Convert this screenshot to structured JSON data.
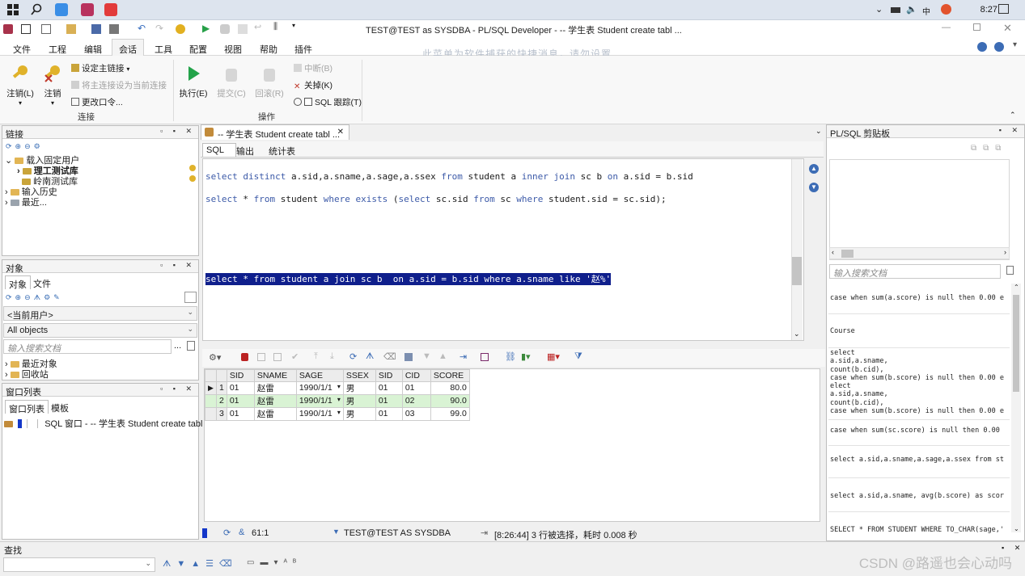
{
  "taskbar": {
    "clock": "8:27"
  },
  "window": {
    "title": "TEST@TEST as SYSDBA - PL/SQL Developer - -- 学生表 Student create tabl ..."
  },
  "menu": {
    "items": [
      "文件",
      "工程",
      "编辑",
      "会话",
      "工具",
      "配置",
      "视图",
      "帮助",
      "插件"
    ],
    "banner": "此菜单为软件捕获的快捷消息，请勿设置"
  },
  "ribbon": {
    "logoff1": "注销(L)",
    "logoff2": "注销",
    "set_main": "设定主链接",
    "set_main_current": "将主连接设为当前连接",
    "change_pwd": "更改口令...",
    "group_connect": "连接",
    "execute": "执行(E)",
    "commit": "提交(C)",
    "rollback": "回滚(R)",
    "break": "中断(B)",
    "close": "关掉(K)",
    "sql_trace": "SQL 跟踪(T)",
    "group_ops": "操作"
  },
  "connections": {
    "title": "链接",
    "items": [
      "载入固定用户",
      "理工测试库",
      "岭南测试库",
      "输入历史",
      "最近..."
    ]
  },
  "objects": {
    "title": "对象",
    "tab_objects": "对象",
    "tab_files": "文件",
    "current_user": "<当前用户>",
    "all_objects": "All objects",
    "search_placeholder": "输入搜索文档",
    "dots": "...",
    "items": [
      "最近对象",
      "回收站"
    ]
  },
  "window_list": {
    "title": "窗口列表",
    "tab_windows": "窗口列表",
    "tab_templates": "模板",
    "item": "SQL 窗口 - -- 学生表 Student create tabl ..."
  },
  "editor": {
    "doc_tab": "-- 学生表 Student create tabl ...",
    "tabs": [
      "SQL",
      "输出",
      "统计表"
    ],
    "line1_kw1": "select distinct",
    "line1_rest": " a.sid,a.sname,a.sage,a.ssex ",
    "line1_kw2": "from",
    "line1_mid": " student a ",
    "line1_kw3": "inner join",
    "line1_mid2": " sc b ",
    "line1_kw4": "on",
    "line1_end": " a.sid = b.sid",
    "line2_kw1": "select",
    "line2_a": " * ",
    "line2_kw2": "from",
    "line2_b": " student ",
    "line2_kw3": "where exists",
    "line2_c": " (",
    "line2_kw4": "select",
    "line2_d": " sc.sid ",
    "line2_kw5": "from",
    "line2_e": " sc ",
    "line2_kw6": "where",
    "line2_f": " student.sid = sc.sid);",
    "highlight": "select * from student a join sc b  on a.sid = b.sid where a.sname like '赵%'"
  },
  "grid": {
    "columns": [
      "SID",
      "SNAME",
      "SAGE",
      "SSEX",
      "SID",
      "CID",
      "SCORE"
    ],
    "rows": [
      {
        "n": "1",
        "sid": "01",
        "sname": "赵雷",
        "sage": "1990/1/1",
        "ssex": "男",
        "sid2": "01",
        "cid": "01",
        "score": "80.0"
      },
      {
        "n": "2",
        "sid": "01",
        "sname": "赵雷",
        "sage": "1990/1/1",
        "ssex": "男",
        "sid2": "01",
        "cid": "02",
        "score": "90.0"
      },
      {
        "n": "3",
        "sid": "01",
        "sname": "赵雷",
        "sage": "1990/1/1",
        "ssex": "男",
        "sid2": "01",
        "cid": "03",
        "score": "99.0"
      }
    ]
  },
  "status": {
    "position": "61:1",
    "connection": "TEST@TEST AS SYSDBA",
    "message": "[8:26:44] 3 行被选择，耗时 0.008 秒"
  },
  "find": {
    "title": "查找"
  },
  "clipboard": {
    "title": "PL/SQL 剪贴板",
    "search_placeholder": "输入搜索文档",
    "entries": [
      "case when sum(a.score) is null then 0.00 e",
      "Course",
      "select\na.sid,a.sname,\ncount(b.cid),\ncase when sum(b.score) is null then 0.00 e\nelect\na.sid,a.sname,\ncount(b.cid),\ncase when sum(b.score) is null then 0.00 e",
      "case when sum(sc.score) is null then 0.00",
      "select a.sid,a.sname,a.sage,a.ssex from st",
      "select a.sid,a.sname, avg(b.score) as scor",
      "SELECT * FROM STUDENT WHERE TO_CHAR(sage,'"
    ]
  },
  "watermark": "CSDN @路遥也会心动吗"
}
